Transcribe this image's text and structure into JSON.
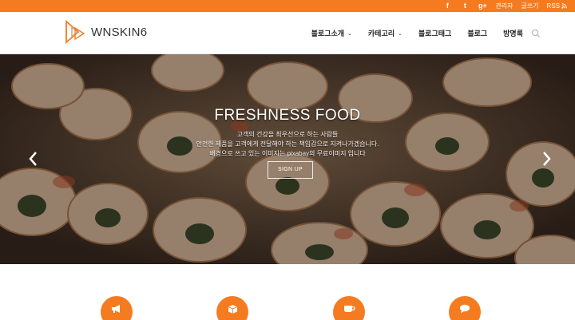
{
  "topbar": {
    "social_icons": [
      "facebook-icon",
      "twitter-icon",
      "google-plus-icon"
    ],
    "facebook": "f",
    "twitter": "t",
    "google_plus": "g+",
    "admin": "관리자",
    "write": "글쓰기",
    "rss": "RSS",
    "accent": "#f47b20"
  },
  "header": {
    "site_name": "WNSKIN6",
    "nav": [
      {
        "label": "블로그소개",
        "has_dropdown": true
      },
      {
        "label": "카테고리",
        "has_dropdown": true
      },
      {
        "label": "블로그태그",
        "has_dropdown": false
      },
      {
        "label": "블로그",
        "has_dropdown": false
      },
      {
        "label": "방명록",
        "has_dropdown": false
      }
    ],
    "search_icon": "search-icon"
  },
  "hero": {
    "title": "FRESHNESS FOOD",
    "line1": "고객의 건강을 최우선으로 하는 사람들",
    "line2": "안전한 제품을 고객에게 전달해야 하는 책임감으로 지켜나가겠습니다.",
    "line3": "배경으로 쓰고 있는 이미지는 pixabay의 무료이미지 입니다",
    "cta": "SIGN UP"
  },
  "features": {
    "icons": [
      "megaphone-icon",
      "cube-icon",
      "coffee-cup-icon",
      "chat-bubble-icon"
    ],
    "color": "#f47b20"
  }
}
